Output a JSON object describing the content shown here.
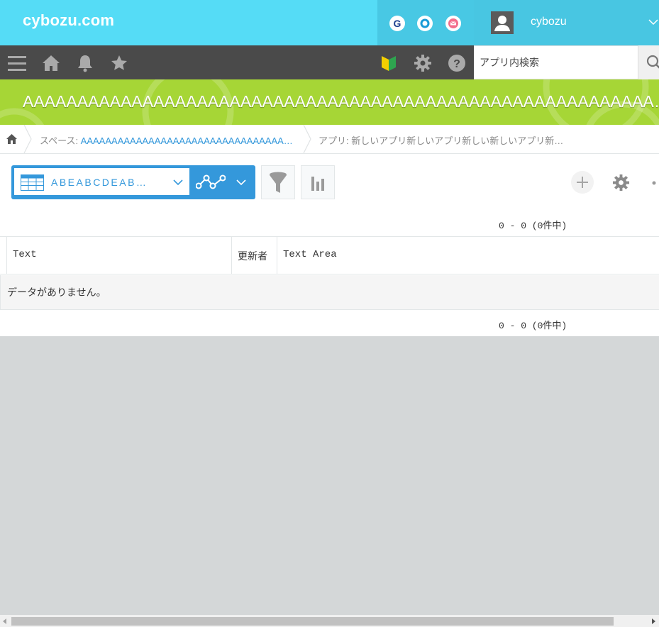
{
  "header": {
    "logo": "cybozu.com",
    "services": [
      {
        "name": "garoon",
        "glyph": "G"
      },
      {
        "name": "office",
        "glyph": "O"
      },
      {
        "name": "mailwise",
        "glyph": "✉"
      }
    ],
    "username": "cybozu"
  },
  "navbar": {
    "search_placeholder": "アプリ内検索"
  },
  "space": {
    "title": "AAAAAAAAAAAAAAAAAAAAAAAAAAAAAAAAAAAAAAAAAAAAAAAAAAAAAAAAAA…"
  },
  "breadcrumb": {
    "space_prefix": "スペース: ",
    "space_name": "AAAAAAAAAAAAAAAAAAAAAAAAAAAAAAAAA…",
    "app_text": "アプリ: 新しいアプリ新しいアプリ新しい新しいアプリ新…"
  },
  "toolbar": {
    "view_name": "ABEABCDEAB…"
  },
  "records": {
    "pager_top": "0 - 0 (0件中)",
    "pager_bottom": "0 - 0 (0件中)",
    "columns": [
      "Text",
      "更新者",
      "Text Area"
    ],
    "empty_message": "データがありません。"
  },
  "colors": {
    "header_bg": "#55dcf6",
    "nav_bg": "#4a4a4a",
    "banner_bg": "#a6d636",
    "accent": "#3498db"
  }
}
